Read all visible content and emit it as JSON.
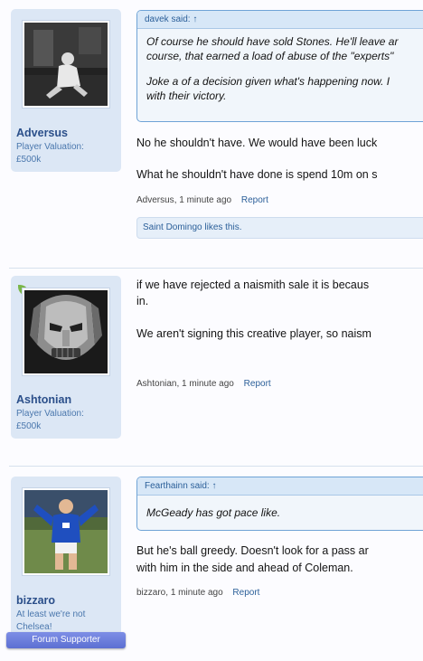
{
  "posts": [
    {
      "username": "Adversus",
      "title_line1": "Player Valuation:",
      "title_line2": "£500k",
      "quote": {
        "author_line": "davek said: ↑",
        "paragraphs": [
          "Of course he should have sold Stones. He'll leave ar",
          "course, that earned a load of abuse of the \"experts\"",
          "Joke a of a decision given what's happening now. I",
          "with their victory."
        ]
      },
      "message_lines": [
        "No he shouldn't have. We would have been luck",
        "What he shouldn't have done is spend 10m on s"
      ],
      "meta": {
        "author": "Adversus",
        "time": "1 minute ago",
        "report": "Report"
      },
      "likes": "Saint Domingo likes this."
    },
    {
      "username": "Ashtonian",
      "title_line1": "Player Valuation:",
      "title_line2": "£500k",
      "message_lines": [
        "if we have rejected a naismith sale it is becaus",
        "in.",
        "We aren't signing this creative player, so naism"
      ],
      "meta": {
        "author": "Ashtonian",
        "time": "1 minute ago",
        "report": "Report"
      }
    },
    {
      "username": "bizzaro",
      "title_line1": "At least we're not",
      "title_line2": "Chelsea!",
      "supporter_badge": "Forum Supporter",
      "quote": {
        "author_line": "Fearthainn said: ↑",
        "paragraphs": [
          "McGeady has got pace like."
        ]
      },
      "message_lines": [
        "But he's ball greedy. Doesn't look for a pass ar",
        "with him in the side and ahead of Coleman."
      ],
      "meta": {
        "author": "bizzaro",
        "time": "1 minute ago",
        "report": "Report"
      }
    }
  ],
  "colors": {
    "accent": "#2b5f99",
    "sidebar_bg": "#dce7f5",
    "quote_border": "#6fa3d6",
    "supporter_badge": "#6a7ddb",
    "online_indicator": "#7ab648"
  }
}
